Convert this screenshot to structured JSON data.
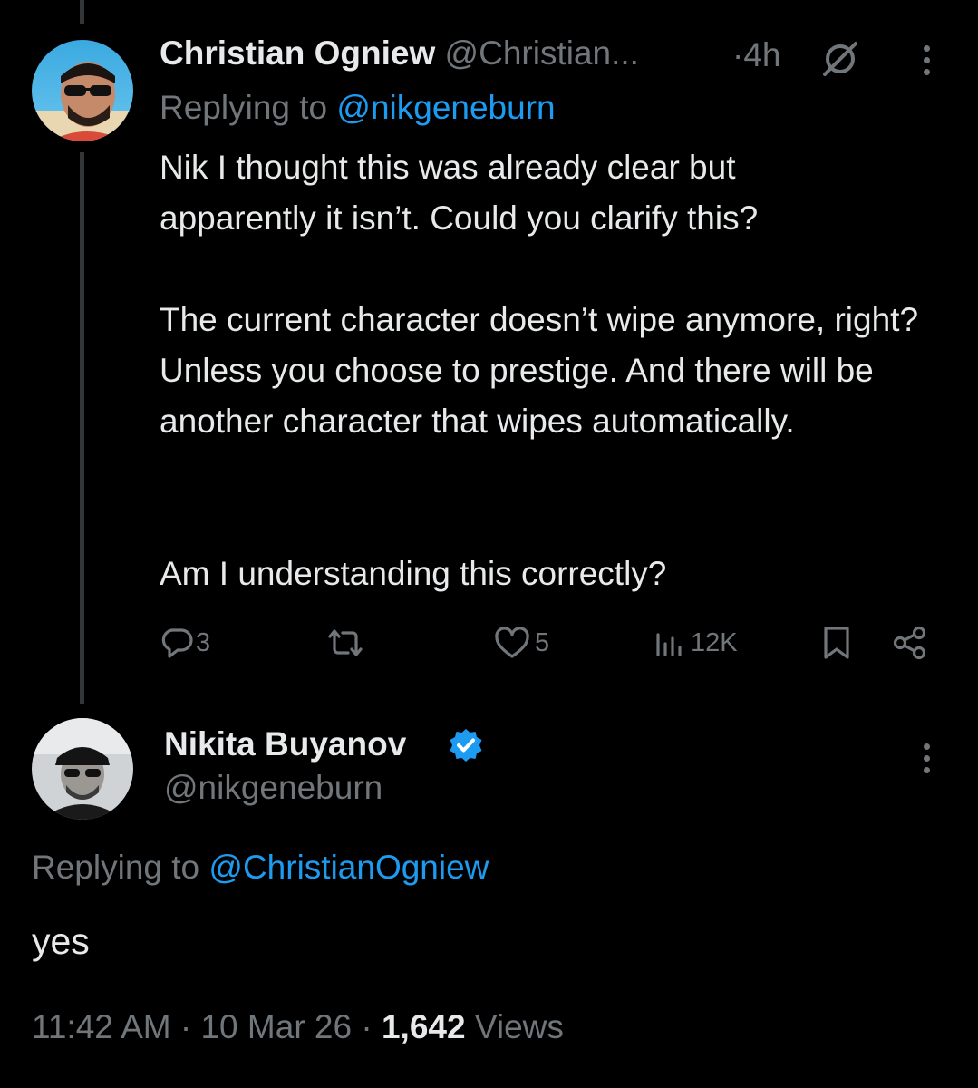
{
  "parent_tweet": {
    "display_name": "Christian Ogniew",
    "handle": "@Christian...",
    "time": "·4h",
    "replying_prefix": "Replying to",
    "replying_handle": "@nikgeneburn",
    "body_paragraphs": [
      "Nik I thought this was already clear but apparently it isn’t. Could you clarify this?",
      "The current character doesn’t wipe anymore, right? Unless you choose to prestige. And there will be another character that wipes automatically.",
      "Am I understanding this correctly?"
    ],
    "reply_count": "3",
    "like_count": "5",
    "view_count": "12K"
  },
  "main_tweet": {
    "display_name": "Nikita Buyanov",
    "handle": "@nikgeneburn",
    "replying_prefix": "Replying to",
    "replying_handle": "@ChristianOgniew",
    "body": "yes",
    "time": "11:42 AM",
    "date": "10 Mar 26",
    "views_count": "1,642",
    "views_label": "Views"
  },
  "colors": {
    "background": "#000000",
    "text": "#e7e9ea",
    "muted": "#71767b",
    "accent": "#1d9bf0"
  },
  "icons": [
    "reply-icon",
    "retweet-icon",
    "like-icon",
    "views-icon",
    "bookmark-icon",
    "share-icon",
    "more-icon",
    "verified-icon",
    "edited-slash-icon"
  ]
}
